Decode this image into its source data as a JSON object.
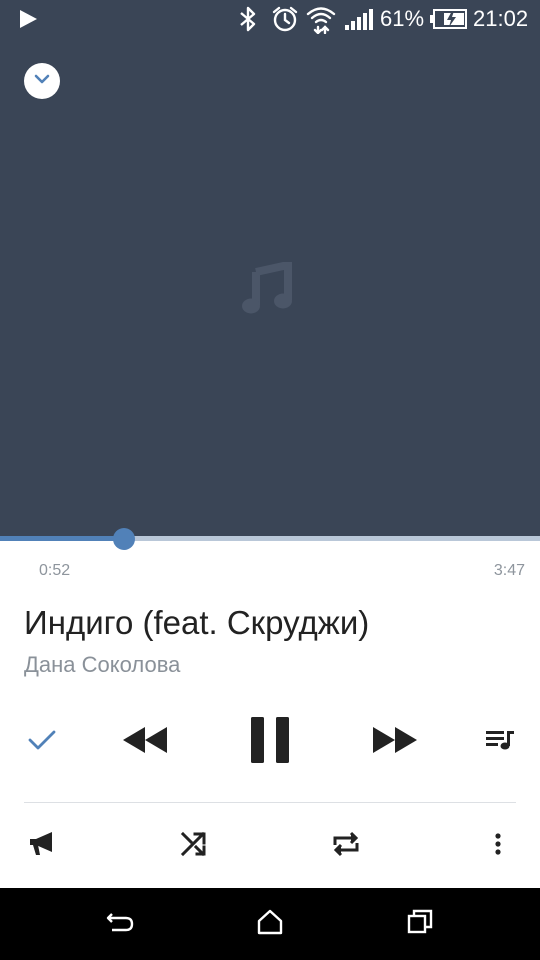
{
  "status_bar": {
    "battery_percent": "61%",
    "time": "21:02",
    "icons": [
      "play-notification-icon",
      "bluetooth-icon",
      "alarm-icon",
      "wifi-icon",
      "signal-icon",
      "battery-charging-icon"
    ]
  },
  "player": {
    "progress_fraction": 0.229,
    "elapsed": "0:52",
    "duration": "3:47",
    "title": "Индиго (feat. Скруджи)",
    "artist": "Дана Соколова"
  },
  "colors": {
    "background_dark": "#3a4556",
    "accent": "#5181b8",
    "text_primary": "#222222",
    "text_secondary": "#8a9199"
  },
  "controls": {
    "primary": [
      "check-icon",
      "previous-icon",
      "pause-icon",
      "next-icon",
      "playlist-icon"
    ],
    "secondary": [
      "broadcast-icon",
      "shuffle-icon",
      "repeat-icon",
      "more-icon"
    ]
  },
  "nav_bar": {
    "icons": [
      "back-icon",
      "home-icon",
      "recents-icon"
    ]
  }
}
